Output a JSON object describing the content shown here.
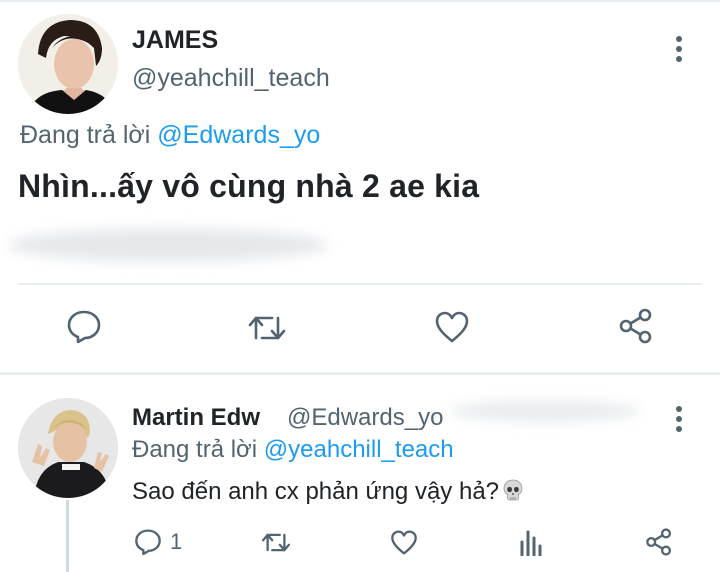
{
  "tweet": {
    "author_name": "JAMES",
    "author_handle": "@yeahchill_teach",
    "reply_prefix": "Đang trả lời",
    "reply_to": "@Edwards_yo",
    "text": "Nhìn...ấy vô cùng nhà 2 ae kia",
    "actions": [
      {
        "name": "reply",
        "icon": "comment-icon"
      },
      {
        "name": "retweet",
        "icon": "retweet-icon"
      },
      {
        "name": "like",
        "icon": "heart-icon"
      },
      {
        "name": "share",
        "icon": "share-icon"
      }
    ]
  },
  "reply": {
    "author_name": "Martin Edw",
    "author_handle": "@Edwards_yo",
    "reply_prefix": "Đang trả lời",
    "reply_to": "@yeahchill_teach",
    "text": "Sao đến anh cx phản ứng vậy hả?",
    "emoji": "skull-emoji",
    "reply_count": "1",
    "actions": [
      {
        "name": "reply",
        "icon": "comment-icon"
      },
      {
        "name": "retweet",
        "icon": "retweet-icon"
      },
      {
        "name": "like",
        "icon": "heart-icon"
      },
      {
        "name": "analytics",
        "icon": "bar-chart-icon"
      },
      {
        "name": "share",
        "icon": "share-icon"
      }
    ]
  },
  "colors": {
    "link": "#1d9bf0",
    "secondary_text": "#536471",
    "primary_text": "#202327",
    "divider": "#e6ecf0"
  }
}
